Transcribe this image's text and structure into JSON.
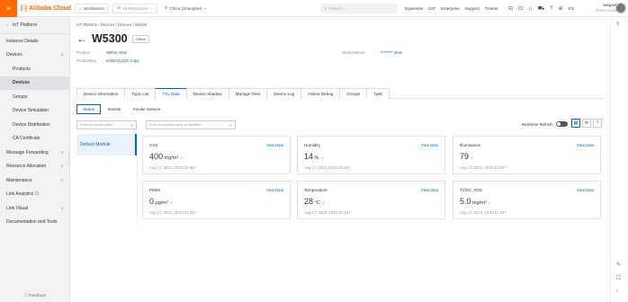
{
  "topbar": {
    "brand": "Alibaba Cloud",
    "workbench": "Workbench",
    "resource_group": "All Resources",
    "region": "China (Shanghai)",
    "search_placeholder": "Search...",
    "links": [
      "Expenses",
      "ICP",
      "Enterprise",
      "Support",
      "Tickets"
    ],
    "lang": "EN",
    "user_name": "weigaolin",
    "user_sub": "RAM Account"
  },
  "sidebar": {
    "back": "IoT Platform",
    "items": [
      {
        "label": "Instance Details",
        "chev": ""
      },
      {
        "label": "Devices",
        "chev": "∧"
      },
      {
        "label": "Products",
        "chev": ""
      },
      {
        "label": "Devices",
        "chev": ""
      },
      {
        "label": "Groups",
        "chev": ""
      },
      {
        "label": "Device Simulation",
        "chev": ""
      },
      {
        "label": "Device Distribution",
        "chev": ""
      },
      {
        "label": "CA Certificate",
        "chev": ""
      },
      {
        "label": "Message Forwarding",
        "chev": "∨"
      },
      {
        "label": "Resource Allocation",
        "chev": "∨"
      },
      {
        "label": "Maintenance",
        "chev": "∨"
      },
      {
        "label": "Link Analytics ☐",
        "chev": ""
      },
      {
        "label": "Link Visual",
        "chev": "∨"
      },
      {
        "label": "Documentation and Tools",
        "chev": ""
      }
    ],
    "feedback": "Feedback"
  },
  "breadcrumb": "IoT Platform / Devices / Devices / W5300",
  "page": {
    "title": "W5300",
    "status": "Offline",
    "product_label": "Product",
    "product_value": "W5hot",
    "product_link": "View",
    "productkey_label": "ProductKey",
    "productkey_value": "a1MjKGyQiO",
    "productkey_link": "Copy",
    "devicesecret_label": "DeviceSecret",
    "devicesecret_value": "********",
    "devicesecret_link": "View"
  },
  "tabs": [
    "Device Information",
    "Topic List",
    "TSL Data",
    "Device Shadow",
    "Manage Files",
    "Device Log",
    "Online Debug",
    "Groups",
    "Task"
  ],
  "subtabs": [
    "Status",
    "Events",
    "Invoke Service"
  ],
  "module_search_placeholder": "Enter a module name",
  "module_item": "Default Module",
  "prop_search_placeholder": "Enter a property name or identifier",
  "realtime_refresh": "Real-time Refresh",
  "cards": [
    {
      "name": "CO2",
      "view": "View Data",
      "value": "400",
      "unit": " mg/m³",
      "ts": "Aug 17, 2023, 19:34:02.847"
    },
    {
      "name": "Humidity",
      "view": "View Data",
      "value": "14",
      "unit": " %",
      "ts": "Aug 17, 2023, 19:34:02.847"
    },
    {
      "name": "Illuminance",
      "view": "View Data",
      "value": "79",
      "unit": "",
      "ts": "Aug 17, 2023, 19:34:02.847"
    },
    {
      "name": "PM25",
      "view": "View Data",
      "value": "0",
      "unit": " μg/m³",
      "ts": "Aug 17, 2023, 19:34:02.847"
    },
    {
      "name": "Temperature",
      "view": "View Data",
      "value": "28",
      "unit": " °C",
      "ts": "Aug 17, 2023, 19:34:02.847"
    },
    {
      "name": "TVOC_VOC",
      "view": "View Data",
      "value": "5.0",
      "unit": " mg/m³",
      "ts": "Aug 17, 2023, 19:34:02.847"
    }
  ]
}
